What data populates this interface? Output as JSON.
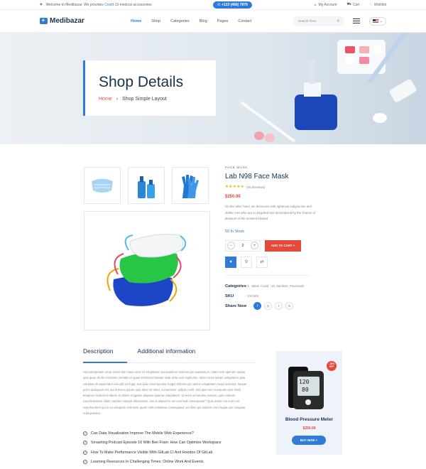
{
  "topbar": {
    "welcome_prefix": "Welcome to Medibazar. We provides",
    "covid_link": "Covid-19",
    "welcome_suffix": "medical accessories",
    "phone": "+133 (466) 7879",
    "account": "My Account",
    "cart": "Cart",
    "wishlist": "Wishlist"
  },
  "header": {
    "brand": "Medibazar",
    "nav": [
      "Home",
      "Shop",
      "Categories",
      "Blog",
      "Pages",
      "Contact"
    ],
    "active_nav": "Home",
    "search_placeholder": "Search here"
  },
  "hero": {
    "title": "Shop Details",
    "breadcrumb": [
      "Home",
      "Shop Simple Layout"
    ]
  },
  "product": {
    "category": "FACE MASK",
    "name": "Lab N98 Face Mask",
    "rating": 4.5,
    "reviews": "(05 Reviews)",
    "price": "$250.99",
    "description": "On the other hand, we denounce with righteous indigna tion and dislike men who are so beguiled and demoralized by the charms of pleasure of the moment blinded",
    "stock": "50 In Stock",
    "quantity": "2",
    "add_to_cart": "ADD TO CART +",
    "categories_label": "Categories :",
    "categories_value": "Mask, Covid - 19, Sanitizer, Facemask",
    "sku_label": "SKU",
    "sku_value": ": 01C0K6",
    "share_label": "Share Now"
  },
  "tabs": {
    "description": "Description",
    "additional": "Additional information"
  },
  "description_text": "Sed perspiciatis unde omnis iste natus error sit voluptatem accusantium doloremque laudantium, totam rem aperiam eaque ipsa quae ab illo inventore veritatis et quasi architecto beatae vitae dicta sunt explicabo. Nemo enim ipsam voluptatem quia voluptas sit aspernatur aut odit aut fugit, sed quia consequuntur magni dolores qui ratione voluptatem sequi nesciunt. Neque porro quisquam est, qui dolorem ipsum quia dolor sit amet, consectetur, adipisci velit, sed quia non numquam eius modi tempora incidunt ut labore et dolore magnam aliquam quaerat voluptatem. Ut enim ad minima veniam, quis nostrum exercitationem ullam corporis suscipit laboriosam, nisi ut aliquid ex ea commodi consequatur? Quis autem vel eum iure reprehenderit qui in ea voluptate velit esse quam nihil molestiae consequatur, vel illum qui dolorem eum fugiat quo voluptas nulla pariatur.",
  "checklist": [
    "Can Data Visualization Improve The Mobile Web Experience?",
    "Smashing Podcast Episode 16 With Ben Frain: How Can Optimize Workspace",
    "How To Make Performance Visible With GitLab CI And Hoodoo Of GitLab",
    "Learning Resources In Challenging Times: Online Work And Events"
  ],
  "promo": {
    "badge": "- 20% OFF",
    "title": "Blood Pressure Meter",
    "price": "$250.99",
    "button": "BUY NOW +"
  },
  "colors": {
    "accent": "#2f7bd9",
    "sale": "#e44a3b",
    "heading": "#17324d"
  }
}
